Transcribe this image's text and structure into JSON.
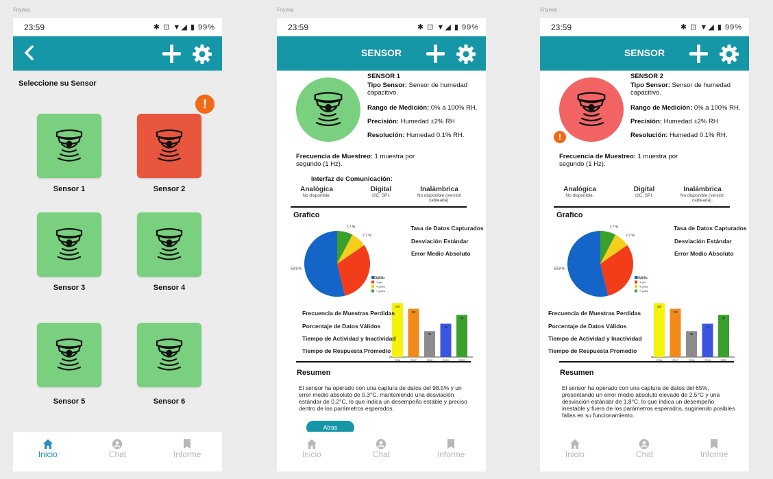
{
  "frames": [
    "Frame",
    "Frame",
    "Frame"
  ],
  "status": {
    "time": "23:59",
    "battery": "99%",
    "icons": "✱ ⊡ ▼◢ ▮"
  },
  "nav": [
    {
      "label": "Inicio",
      "icon": "home-icon"
    },
    {
      "label": "Chat",
      "icon": "person-icon"
    },
    {
      "label": "Informe",
      "icon": "bookmark-icon"
    }
  ],
  "colors": {
    "teal": "#1597a8",
    "green": "#79d07f",
    "red": "#e8563e",
    "orange": "#f26a18"
  },
  "list_screen": {
    "heading": "Seleccione su Sensor",
    "sensors": [
      {
        "label": "Sensor 1",
        "status": "ok"
      },
      {
        "label": "Sensor 2",
        "status": "alert"
      },
      {
        "label": "Sensor 3",
        "status": "ok"
      },
      {
        "label": "Sensor 4",
        "status": "ok"
      },
      {
        "label": "Sensor 5",
        "status": "ok"
      },
      {
        "label": "Sensor 6",
        "status": "ok"
      }
    ],
    "alert_symbol": "!"
  },
  "detail_title": "SENSOR",
  "details": [
    {
      "name": "SENSOR 1",
      "tipo_label": "Tipo Sensor:",
      "tipo_value": " Sensor de humedad capacitivo.",
      "rango_label": "Rango de Medición:",
      "rango_value": " 0% a 100% RH.",
      "precision_label": "Precisión:",
      "precision_value": " Humedad ±2% RH",
      "resolucion_label": "Resolución:",
      "resolucion_value": " Humedad 0.1% RH.",
      "frecuencia_label": "Frecuencia de Muestreo:",
      "frecuencia_value": " 1 muestra por segundo (1 Hz).",
      "interfaz_title": "Interfaz de Comunicación:",
      "iface": [
        {
          "h": "Analógica",
          "s": "No disponible."
        },
        {
          "h": "Digital",
          "s": "I2C, SPI."
        },
        {
          "h": "Inalámbrica",
          "s": "No disponible (versión cableada)."
        }
      ],
      "grafico": "Grafico",
      "pie_labels": [
        "Tasa de Datos Capturados",
        "Desviación Estándar",
        "Error Medio Absoluto"
      ],
      "bar_labels": [
        "Frecuencia de Muestras Perdidas",
        "Porcentaje de Datos Válidos",
        "Tiempo de Actividad y Inactividad",
        "Tiempo de Respuesta Promedio"
      ],
      "resumen": "Resumen",
      "summary": "El sensor ha operado con una captura de datos del 98.5% y un error medio absoluto de 0.3°C, manteniendo una desviación estándar de 0.2°C, lo que indica un desempeño estable y preciso dentro de los parámetros esperados.",
      "atras": "Atras"
    },
    {
      "name": "SENSOR 2",
      "tipo_label": "Tipo Sensor:",
      "tipo_value": " Sensor de humedad capacitivo.",
      "rango_label": "Rango de Medición:",
      "rango_value": " 0% a 100% RH.",
      "precision_label": "Precisión:",
      "precision_value": " Humedad ±2% RH",
      "resolucion_label": "Resolución:",
      "resolucion_value": " Humedad 0.1% RH.",
      "frecuencia_label": "Frecuencia de Muestreo:",
      "frecuencia_value": " 1 muestra por segundo (1 Hz).",
      "interfaz_title": "",
      "iface": [
        {
          "h": "Analógica",
          "s": "No disponible."
        },
        {
          "h": "Digital",
          "s": "I2C, SPI."
        },
        {
          "h": "Inalámbrica",
          "s": "No disponible (versión cableada)."
        }
      ],
      "grafico": "Grafico",
      "pie_labels": [
        "Tasa de Datos Capturados",
        "Desviación Estándar",
        "Error Medio Absoluto"
      ],
      "bar_labels": [
        "Frecuencia de Muestras Perdidas",
        "Porcentaje de Datos Válidos",
        "Tiempo de Actividad y Inactividad",
        "Tiempo de Respuesta Promedio"
      ],
      "resumen": "Resumen",
      "summary": "El sensor ha operado con una captura de datos del 65%, presentando un error medio absoluto elevado de 2.5°C y una desviación estándar de 1.8°C, lo que indica un desempeño inestable y fuera de los parámetros esperados, sugiriendo posibles fallas en su funcionamiento.",
      "atras": ""
    }
  ],
  "chart_data": [
    {
      "type": "pie",
      "slices": [
        {
          "name": "5 goles",
          "value": 53.8,
          "label": "53,8 %",
          "color": "#1565c8"
        },
        {
          "name": "1 gol",
          "value": 30.8,
          "label": "30,8 %",
          "color": "#f23c1a"
        },
        {
          "name": "4 goles",
          "value": 7.7,
          "label": "7,7 %",
          "color": "#f6cf1c"
        },
        {
          "name": "7 goles",
          "value": 7.7,
          "label": "7,7 %",
          "color": "#3aa02c"
        }
      ]
    },
    {
      "type": "bar",
      "categories": [
        "2016",
        "2017",
        "2018",
        "2019",
        "2020"
      ],
      "values": [
        123,
        110,
        59,
        76,
        96
      ],
      "value_labels": [
        "123",
        "110",
        "59",
        "76",
        "96"
      ],
      "colors": [
        "#f6f20a",
        "#f28a1a",
        "#8c8c8c",
        "#3a55e0",
        "#3aa02c"
      ],
      "ylim": [
        0,
        125
      ]
    }
  ]
}
